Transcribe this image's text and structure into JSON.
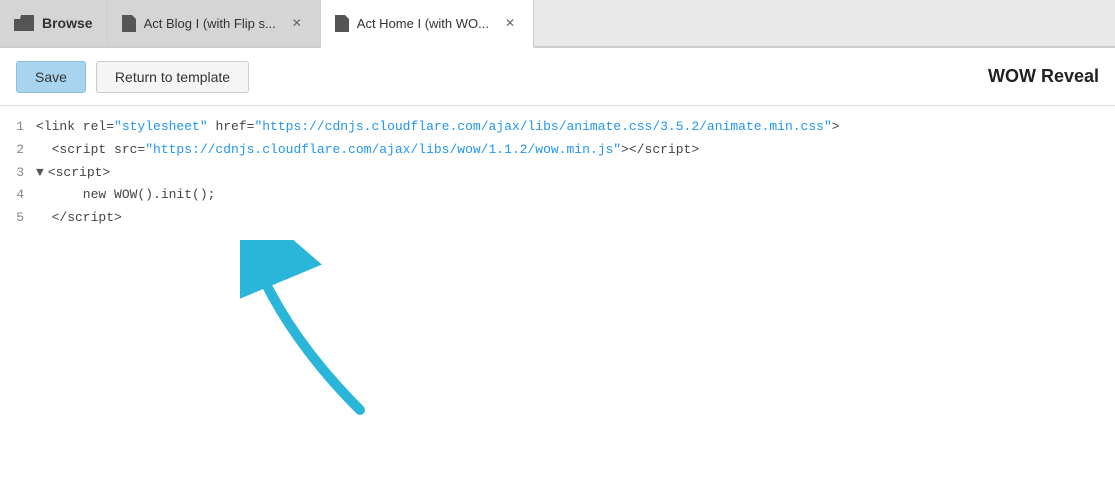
{
  "tabs": [
    {
      "id": "browse",
      "label": "Browse",
      "icon": "folder-icon",
      "active": false,
      "closeable": false,
      "type": "browse"
    },
    {
      "id": "blog",
      "label": "Act Blog I (with Flip s...",
      "icon": "page-icon",
      "active": false,
      "closeable": true,
      "type": "page"
    },
    {
      "id": "home",
      "label": "Act Home I (with WO...",
      "icon": "page-icon",
      "active": true,
      "closeable": true,
      "type": "page"
    }
  ],
  "toolbar": {
    "save_label": "Save",
    "return_label": "Return to template",
    "title": "WOW Reveal"
  },
  "code": {
    "lines": [
      {
        "number": "1",
        "content": "<link rel=\"stylesheet\" href=\"https://cdnjs.cloudflare.com/ajax/libs/animate.css/3.5.2/animate.min.css\">",
        "collapsible": false
      },
      {
        "number": "2",
        "content": "  <script src=\"https://cdnjs.cloudflare.com/ajax/libs/wow/1.1.2/wow.min.js\"><\\/script>",
        "collapsible": false
      },
      {
        "number": "3",
        "content": "  <script>",
        "collapsible": true
      },
      {
        "number": "4",
        "content": "      new WOW().init();",
        "collapsible": false
      },
      {
        "number": "5",
        "content": "  <\\/script>",
        "collapsible": false
      }
    ]
  }
}
